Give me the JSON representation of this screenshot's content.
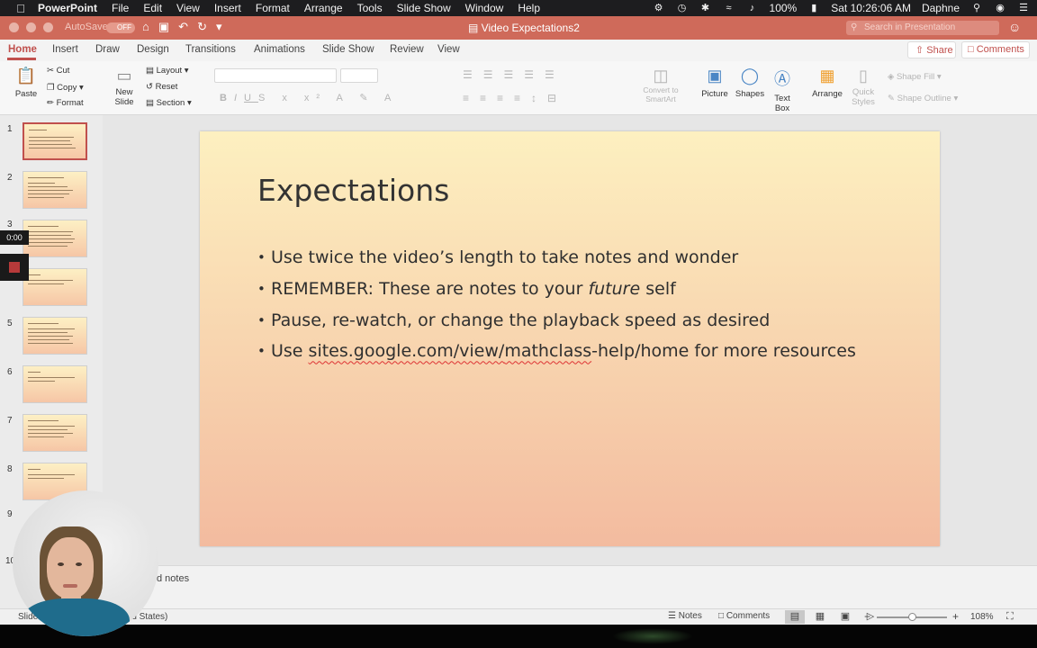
{
  "menubar": {
    "app": "PowerPoint",
    "menus": [
      "File",
      "Edit",
      "View",
      "Insert",
      "Format",
      "Arrange",
      "Tools",
      "Slide Show",
      "Window",
      "Help"
    ],
    "battery": "100%",
    "datetime": "Sat 10:26:06 AM",
    "user": "Daphne"
  },
  "titlebar": {
    "autosave": "AutoSave",
    "autosave_state": "OFF",
    "doc_title": "Video Expectations2",
    "search_placeholder": "Search in Presentation"
  },
  "ribbon": {
    "tabs": [
      "Home",
      "Insert",
      "Draw",
      "Design",
      "Transitions",
      "Animations",
      "Slide Show",
      "Review",
      "View"
    ],
    "active_tab": "Home",
    "share": "Share",
    "comments": "Comments",
    "paste": "Paste",
    "cut": "Cut",
    "copy": "Copy",
    "format": "Format",
    "new_slide": "New Slide",
    "layout": "Layout",
    "reset": "Reset",
    "section": "Section",
    "convert_smartart": "Convert to SmartArt",
    "picture": "Picture",
    "shapes": "Shapes",
    "text_box": "Text Box",
    "arrange": "Arrange",
    "quick_styles": "Quick Styles",
    "shape_fill": "Shape Fill",
    "shape_outline": "Shape Outline"
  },
  "slide_panel": {
    "numbers": [
      "1",
      "2",
      "3",
      "4",
      "5",
      "6",
      "7",
      "8",
      "9",
      "10"
    ],
    "selected": "1"
  },
  "recorder": {
    "time": "0:00"
  },
  "slide": {
    "title": "Expectations",
    "bullets": [
      "Use twice the video’s length to take notes and wonder",
      "Pause, re-watch, or change the playback speed as desired"
    ],
    "bullet2_prefix": "REMEMBER: These are notes to your ",
    "bullet2_italic": "future",
    "bullet2_suffix": " self",
    "bullet4_prefix": "Use ",
    "bullet4_link_a": "sites.google.com/view/",
    "bullet4_link_b": "mathclass",
    "bullet4_link_c": "-help/home",
    "bullet4_suffix": " for more resources"
  },
  "notes": {
    "placeholder_visible": "d notes"
  },
  "status": {
    "slide_info": "Slide",
    "language": "ted States)",
    "notes": "Notes",
    "comments": "Comments",
    "zoom": "108%"
  }
}
